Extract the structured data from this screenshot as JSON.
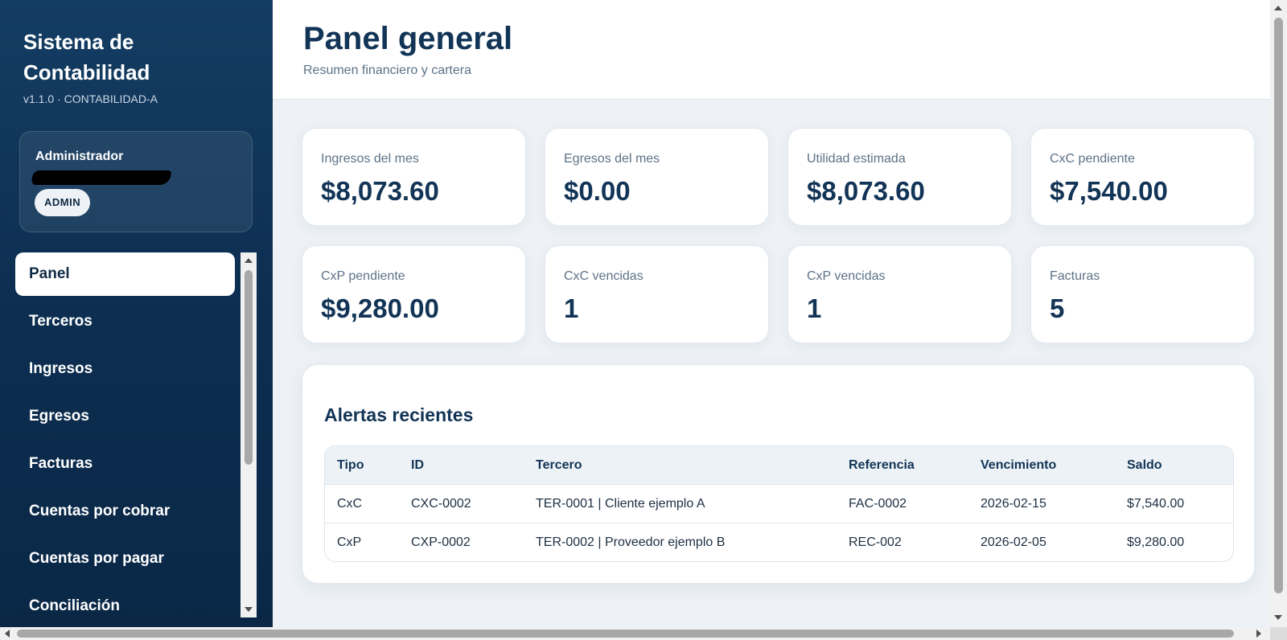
{
  "sidebar": {
    "brand_title": "Sistema de Contabilidad",
    "version": "v1.1.0 · CONTABILIDAD-A",
    "user": {
      "role": "Administrador",
      "badge": "ADMIN"
    },
    "items": [
      {
        "label": "Panel",
        "active": true
      },
      {
        "label": "Terceros"
      },
      {
        "label": "Ingresos"
      },
      {
        "label": "Egresos"
      },
      {
        "label": "Facturas"
      },
      {
        "label": "Cuentas por cobrar"
      },
      {
        "label": "Cuentas por pagar"
      },
      {
        "label": "Conciliación"
      }
    ]
  },
  "header": {
    "title": "Panel general",
    "subtitle": "Resumen financiero y cartera"
  },
  "cards": [
    {
      "label": "Ingresos del mes",
      "value": "$8,073.60"
    },
    {
      "label": "Egresos del mes",
      "value": "$0.00"
    },
    {
      "label": "Utilidad estimada",
      "value": "$8,073.60"
    },
    {
      "label": "CxC pendiente",
      "value": "$7,540.00"
    },
    {
      "label": "CxP pendiente",
      "value": "$9,280.00"
    },
    {
      "label": "CxC vencidas",
      "value": "1"
    },
    {
      "label": "CxP vencidas",
      "value": "1"
    },
    {
      "label": "Facturas",
      "value": "5"
    }
  ],
  "alerts": {
    "title": "Alertas recientes",
    "columns": [
      "Tipo",
      "ID",
      "Tercero",
      "Referencia",
      "Vencimiento",
      "Saldo"
    ],
    "rows": [
      [
        "CxC",
        "CXC-0002",
        "TER-0001 | Cliente ejemplo A",
        "FAC-0002",
        "2026-02-15",
        "$7,540.00"
      ],
      [
        "CxP",
        "CXP-0002",
        "TER-0002 | Proveedor ejemplo B",
        "REC-002",
        "2026-02-05",
        "$9,280.00"
      ]
    ]
  },
  "colors": {
    "sidebar_top": "#143d63",
    "sidebar_bottom": "#0a2746",
    "heading": "#123456",
    "muted": "#5d7287"
  }
}
